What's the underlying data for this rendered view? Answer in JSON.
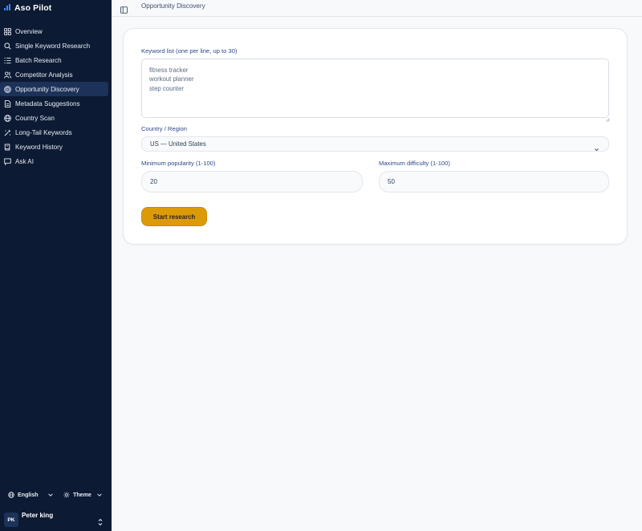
{
  "app": {
    "name": "Aso Pilot",
    "accent": "#dc9b06",
    "sidebar_bg": "#0c1a33"
  },
  "sidebar": {
    "items": [
      {
        "label": "Overview",
        "icon": "grid-icon",
        "active": false
      },
      {
        "label": "Single Keyword Research",
        "icon": "search-icon",
        "active": false
      },
      {
        "label": "Batch Research",
        "icon": "list-icon",
        "active": false
      },
      {
        "label": "Competitor Analysis",
        "icon": "users-icon",
        "active": false
      },
      {
        "label": "Opportunity Discovery",
        "icon": "target-icon",
        "active": true
      },
      {
        "label": "Metadata Suggestions",
        "icon": "document-icon",
        "active": false
      },
      {
        "label": "Country Scan",
        "icon": "globe-icon",
        "active": false
      },
      {
        "label": "Long-Tail Keywords",
        "icon": "sparkle-icon",
        "active": false
      },
      {
        "label": "Keyword History",
        "icon": "book-icon",
        "active": false
      },
      {
        "label": "Ask AI",
        "icon": "chat-icon",
        "active": false
      }
    ],
    "language_label": "English",
    "theme_label": "Theme",
    "user": {
      "initials": "PK",
      "name": "Peter king"
    }
  },
  "header": {
    "title": "Opportunity Discovery"
  },
  "form": {
    "keyword_label": "Keyword list (one per line, up to 30)",
    "keywords_value": "fitness tracker\nworkout planner\nstep counter",
    "country_label": "Country / Region",
    "country_value": "US — United States",
    "min_popularity_label": "Minimum popularity (1-100)",
    "min_popularity_value": "20",
    "max_difficulty_label": "Maximum difficulty (1-100)",
    "max_difficulty_value": "50",
    "submit_label": "Start research"
  }
}
